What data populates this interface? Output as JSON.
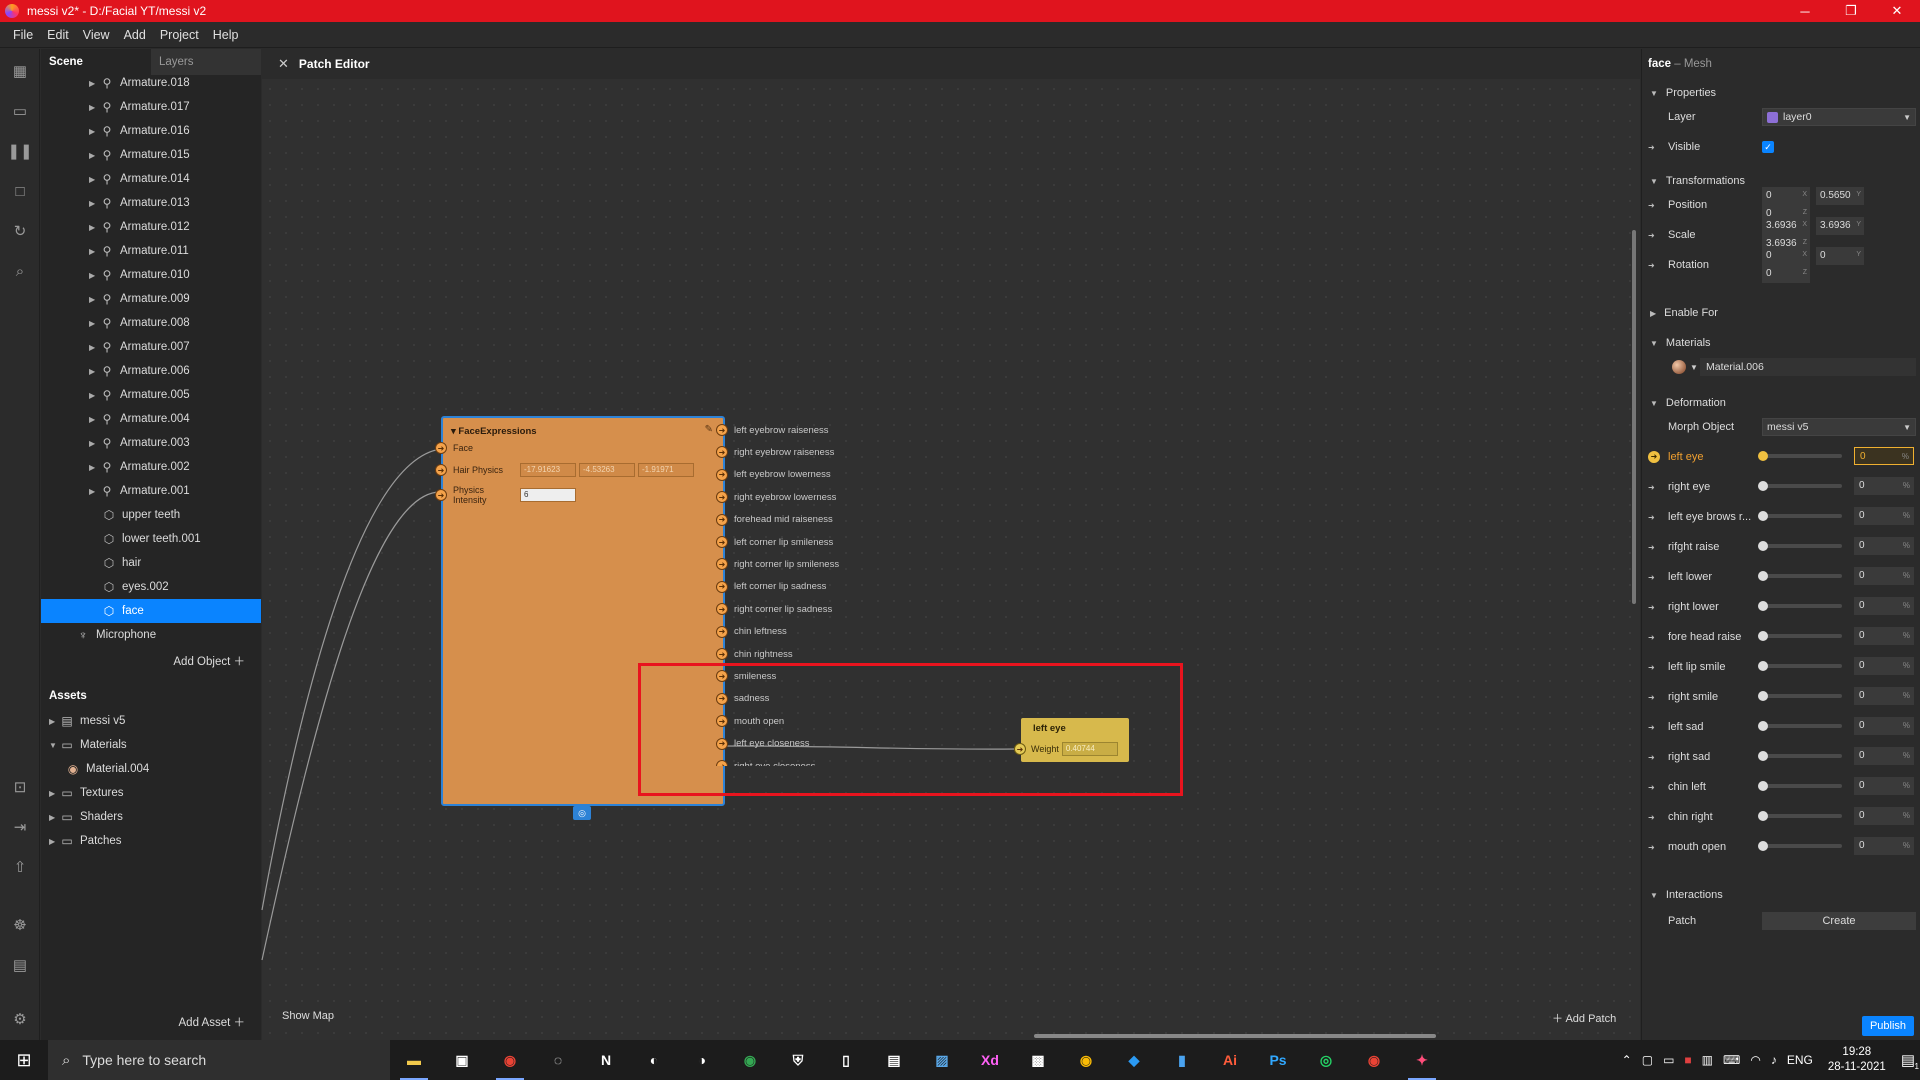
{
  "window": {
    "title": "messi v2* - D:/Facial YT/messi v2"
  },
  "menu": [
    "File",
    "Edit",
    "View",
    "Add",
    "Project",
    "Help"
  ],
  "scene": {
    "tabs": [
      "Scene",
      "Layers"
    ],
    "items": [
      {
        "label": "Armature.018",
        "type": "armature"
      },
      {
        "label": "Armature.017",
        "type": "armature"
      },
      {
        "label": "Armature.016",
        "type": "armature"
      },
      {
        "label": "Armature.015",
        "type": "armature"
      },
      {
        "label": "Armature.014",
        "type": "armature"
      },
      {
        "label": "Armature.013",
        "type": "armature"
      },
      {
        "label": "Armature.012",
        "type": "armature"
      },
      {
        "label": "Armature.011",
        "type": "armature"
      },
      {
        "label": "Armature.010",
        "type": "armature"
      },
      {
        "label": "Armature.009",
        "type": "armature"
      },
      {
        "label": "Armature.008",
        "type": "armature"
      },
      {
        "label": "Armature.007",
        "type": "armature"
      },
      {
        "label": "Armature.006",
        "type": "armature"
      },
      {
        "label": "Armature.005",
        "type": "armature"
      },
      {
        "label": "Armature.004",
        "type": "armature"
      },
      {
        "label": "Armature.003",
        "type": "armature"
      },
      {
        "label": "Armature.002",
        "type": "armature"
      },
      {
        "label": "Armature.001",
        "type": "armature"
      },
      {
        "label": "upper teeth",
        "type": "mesh"
      },
      {
        "label": "lower teeth.001",
        "type": "mesh"
      },
      {
        "label": "hair",
        "type": "mesh"
      },
      {
        "label": "eyes.002",
        "type": "mesh"
      },
      {
        "label": "face",
        "type": "mesh",
        "selected": true
      },
      {
        "label": "Microphone",
        "type": "mic"
      }
    ],
    "add_object": "Add Object"
  },
  "assets": {
    "title": "Assets",
    "items": [
      {
        "label": "messi v5",
        "type": "file",
        "expanded": false,
        "indent": 0
      },
      {
        "label": "Materials",
        "type": "folder",
        "expanded": true,
        "indent": 0
      },
      {
        "label": "Material.004",
        "type": "material",
        "indent": 1
      },
      {
        "label": "Textures",
        "type": "folder",
        "expanded": false,
        "indent": 0
      },
      {
        "label": "Shaders",
        "type": "folder",
        "expanded": false,
        "indent": 0
      },
      {
        "label": "Patches",
        "type": "folder",
        "expanded": false,
        "indent": 0
      }
    ],
    "add_asset": "Add Asset"
  },
  "patch_editor": {
    "title": "Patch Editor",
    "show_map": "Show Map",
    "add_patch": "Add Patch",
    "face_node": {
      "title": "FaceExpressions",
      "inputs": [
        {
          "label": "Face",
          "fields": []
        },
        {
          "label": "Hair Physics",
          "fields": [
            "-17.91623",
            "-4.53263",
            "-1.91971"
          ]
        },
        {
          "label": "Physics Intensity",
          "fields": [
            "6"
          ]
        }
      ],
      "outputs": [
        "left eyebrow raiseness",
        "right eyebrow raiseness",
        "left eyebrow lowerness",
        "right eyebrow lowerness",
        "forehead mid raiseness",
        "left corner lip smileness",
        "right corner lip smileness",
        "left corner lip sadness",
        "right corner lip sadness",
        "chin leftness",
        "chin rightness",
        "smileness",
        "sadness",
        "mouth open",
        "left eye closeness",
        "right eye closeness"
      ]
    },
    "left_eye_node": {
      "title": "left eye",
      "weight_label": "Weight",
      "weight_value": "0.40744"
    }
  },
  "properties": {
    "object_name": "face",
    "object_type": "– Mesh",
    "sections": {
      "properties": "Properties",
      "transformations": "Transformations",
      "enable_for": "Enable For",
      "materials": "Materials",
      "deformation": "Deformation",
      "interactions": "Interactions"
    },
    "layer": {
      "label": "Layer",
      "value": "layer0",
      "color": "#8d6fd6"
    },
    "visible": {
      "label": "Visible",
      "checked": true
    },
    "position": {
      "label": "Position",
      "values": [
        "0",
        "0.5650",
        "0"
      ],
      "axes": [
        "X",
        "Y",
        "Z"
      ]
    },
    "scale": {
      "label": "Scale",
      "values": [
        "3.6936",
        "3.6936",
        "3.6936"
      ],
      "axes": [
        "X",
        "Y",
        "Z"
      ]
    },
    "rotation": {
      "label": "Rotation",
      "values": [
        "0",
        "0",
        "0"
      ],
      "axes": [
        "X",
        "Y",
        "Z"
      ]
    },
    "material": "Material.006",
    "morph_object": {
      "label": "Morph Object",
      "value": "messi v5"
    },
    "morphs": [
      {
        "label": "left eye",
        "value": "0",
        "active": true
      },
      {
        "label": "right eye",
        "value": "0"
      },
      {
        "label": "left eye brows r...",
        "value": "0"
      },
      {
        "label": "rifght raise",
        "value": "0"
      },
      {
        "label": "left lower",
        "value": "0"
      },
      {
        "label": "right lower",
        "value": "0"
      },
      {
        "label": "fore head raise",
        "value": "0"
      },
      {
        "label": "left lip smile",
        "value": "0"
      },
      {
        "label": "right smile",
        "value": "0"
      },
      {
        "label": "left sad",
        "value": "0"
      },
      {
        "label": "right sad",
        "value": "0"
      },
      {
        "label": "chin left",
        "value": "0"
      },
      {
        "label": "chin right",
        "value": "0"
      },
      {
        "label": "mouth open",
        "value": "0"
      }
    ],
    "patch": {
      "label": "Patch",
      "button": "Create"
    },
    "publish": "Publish"
  },
  "taskbar": {
    "search_placeholder": "Type here to search",
    "lang": "ENG",
    "time": "19:28",
    "date": "28-11-2021",
    "notifications": "1"
  }
}
